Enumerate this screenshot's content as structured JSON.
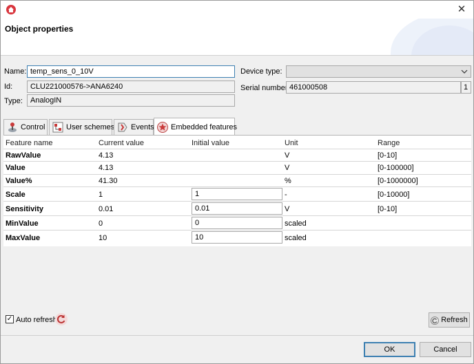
{
  "window": {
    "title": "Object properties",
    "close_glyph": "✕"
  },
  "form": {
    "name_label": "Name:",
    "name_value": "temp_sens_0_10V",
    "id_label": "Id:",
    "id_value": "CLU221000576->ANA6240",
    "type_label": "Type:",
    "type_value": "AnalogIN",
    "device_type_label": "Device type:",
    "device_type_value": "",
    "serial_label": "Serial number:",
    "serial_value": "461000508",
    "serial_count": "1"
  },
  "tabs": [
    {
      "label": "Control",
      "icon": "joystick-icon"
    },
    {
      "label": "User schemes",
      "icon": "scheme-icon"
    },
    {
      "label": "Events",
      "icon": "events-icon"
    },
    {
      "label": "Embedded features",
      "icon": "star-icon",
      "active": true
    }
  ],
  "table": {
    "headers": [
      "Feature name",
      "Current value",
      "Initial value",
      "Unit",
      "Range"
    ],
    "rows": [
      {
        "name": "RawValue",
        "current": "4.13",
        "initial": "",
        "unit": "V",
        "range": "[0-10]",
        "editable": false
      },
      {
        "name": "Value",
        "current": "4.13",
        "initial": "",
        "unit": "V",
        "range": "[0-100000]",
        "editable": false
      },
      {
        "name": "Value%",
        "current": "41.30",
        "initial": "",
        "unit": "%",
        "range": "[0-1000000]",
        "editable": false
      },
      {
        "name": "Scale",
        "current": "1",
        "initial": "1",
        "unit": "-",
        "range": "[0-10000]",
        "editable": true
      },
      {
        "name": "Sensitivity",
        "current": "0.01",
        "initial": "0.01",
        "unit": "V",
        "range": "[0-10]",
        "editable": true
      },
      {
        "name": "MinValue",
        "current": "0",
        "initial": "0",
        "unit": "scaled",
        "range": "",
        "editable": true
      },
      {
        "name": "MaxValue",
        "current": "10",
        "initial": "10",
        "unit": "scaled",
        "range": "",
        "editable": true
      }
    ]
  },
  "footer": {
    "auto_refresh_label": "Auto refresh",
    "auto_refresh_checked": true,
    "refresh_label": "Refresh",
    "ok_label": "OK",
    "cancel_label": "Cancel"
  },
  "colors": {
    "accent": "#3c7fb1",
    "brand_red": "#d9363e"
  }
}
